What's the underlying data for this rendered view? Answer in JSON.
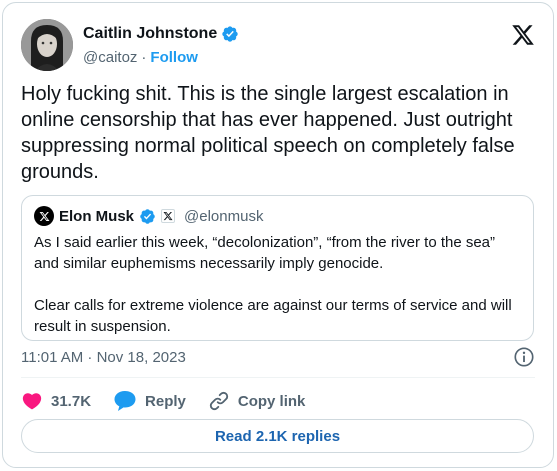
{
  "author": {
    "name": "Caitlin Johnstone",
    "handle": "@caitoz",
    "separator": "·",
    "follow_label": "Follow",
    "verified_color": "#1d9bf0"
  },
  "tweet_text": "Holy fucking shit. This is the single largest escalation in online censorship that has ever happened. Just outright suppressing normal political speech on completely false grounds.",
  "quoted": {
    "name": "Elon Musk",
    "handle": "@elonmusk",
    "paragraphs": [
      "As I said earlier this week, “decolonization”, “from the river to the sea” and similar euphemisms necessarily imply genocide.",
      "Clear calls for extreme violence are against our terms of service and will result in suspension."
    ]
  },
  "timestamp": "11:01 AM · Nov 18, 2023",
  "actions": {
    "likes": "31.7K",
    "reply_label": "Reply",
    "copy_link_label": "Copy link"
  },
  "read_replies_label": "Read 2.1K replies",
  "colors": {
    "like": "#f91880",
    "reply": "#1d9bf0",
    "link": "#1d9bf0",
    "read_replies": "#1d65b0"
  },
  "icons": [
    "x-logo-icon",
    "verified-badge-icon",
    "info-icon",
    "heart-icon",
    "reply-bubble-icon",
    "link-icon",
    "x-badge-icon"
  ]
}
